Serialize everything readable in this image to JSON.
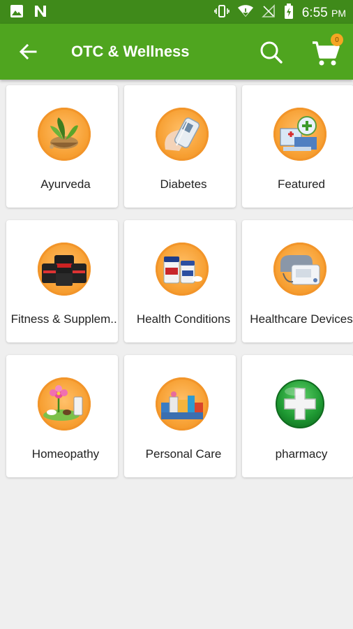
{
  "status": {
    "time": "6:55",
    "ampm": "PM"
  },
  "header": {
    "title": "OTC & Wellness",
    "cart_count": "0"
  },
  "categories": [
    {
      "label": "Ayurveda",
      "icon": "ayurveda-herbs-icon"
    },
    {
      "label": "Diabetes",
      "icon": "glucose-meter-icon"
    },
    {
      "label": "Featured",
      "icon": "medicine-box-icon"
    },
    {
      "label": "Fitness & Supplem...",
      "icon": "supplement-jars-icon"
    },
    {
      "label": "Health Conditions",
      "icon": "medicine-bottles-icon"
    },
    {
      "label": "Healthcare Devices",
      "icon": "bp-monitor-icon"
    },
    {
      "label": "Homeopathy",
      "icon": "flower-herbal-icon"
    },
    {
      "label": "Personal Care",
      "icon": "personal-care-products-icon"
    },
    {
      "label": "pharmacy",
      "icon": "green-cross-icon"
    }
  ],
  "colors": {
    "status_bar": "#3f8a1a",
    "app_bar": "#4fa51f",
    "badge": "#f5a623",
    "icon_bg": "#f7a033"
  }
}
